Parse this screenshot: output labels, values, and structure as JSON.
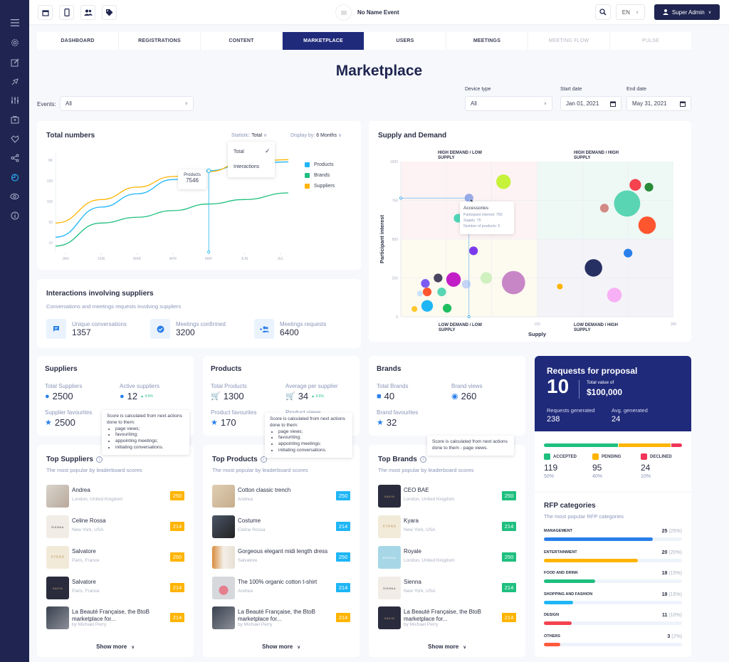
{
  "sidebar": {
    "items": [
      {
        "icon": "menu-icon"
      },
      {
        "icon": "gear-icon"
      },
      {
        "icon": "edit-icon"
      },
      {
        "icon": "rocket-icon"
      },
      {
        "icon": "sliders-icon"
      },
      {
        "icon": "briefcase-icon"
      },
      {
        "icon": "handshake-icon"
      },
      {
        "icon": "share-icon"
      },
      {
        "icon": "pie-chart-icon",
        "active": true
      },
      {
        "icon": "eye-icon"
      },
      {
        "icon": "info-icon"
      }
    ]
  },
  "topbar": {
    "event_name": "No Name Event",
    "language": "EN",
    "user": "Super Admin"
  },
  "tabs": [
    {
      "label": "DASHBOARD"
    },
    {
      "label": "REGISTRATIONS"
    },
    {
      "label": "CONTENT"
    },
    {
      "label": "MARKETPLACE",
      "active": true
    },
    {
      "label": "USERS"
    },
    {
      "label": "MEETINGS"
    },
    {
      "label": "MEETING FLOW",
      "disabled": true
    },
    {
      "label": "PULSE",
      "disabled": true
    }
  ],
  "page_title": "Marketplace",
  "filters": {
    "events_label": "Events:",
    "events_value": "All",
    "device_label": "Device type",
    "device_value": "All",
    "start_label": "Start date",
    "start_value": "Jan 01, 2021",
    "end_label": "End date",
    "end_value": "May 31, 2021"
  },
  "total_numbers": {
    "title": "Total numbers",
    "statistic_label": "Statistic:",
    "statistic_value": "Total",
    "display_label": "Display by:",
    "display_value": "6 Months",
    "dropdown_options": [
      "Total",
      "Interactions"
    ],
    "tooltip_label": "Products",
    "tooltip_value": "7546"
  },
  "chart_data": [
    {
      "type": "line",
      "title": "Total numbers",
      "categories": [
        "JAN",
        "FEB",
        "MAR",
        "APR",
        "MAY",
        "JUN",
        "JUL"
      ],
      "y_ticks": [
        "10",
        "50",
        "100",
        "150",
        "9K"
      ],
      "series": [
        {
          "name": "Products",
          "color": "#1eb6f5",
          "values": [
            10,
            78,
            108,
            140,
            160,
            175,
            180
          ]
        },
        {
          "name": "Brands",
          "color": "#1fbf7f",
          "values": [
            -10,
            42,
            55,
            70,
            85,
            95,
            110
          ]
        },
        {
          "name": "Suppliers",
          "color": "#ffb400",
          "values": [
            42,
            95,
            123,
            147,
            158,
            180,
            185
          ]
        }
      ],
      "legend": "right",
      "highlight": {
        "series": "Products",
        "category": "MAY",
        "value": 7546
      }
    },
    {
      "type": "scatter",
      "title": "Supply and Demand",
      "xlabel": "Supply",
      "ylabel": "Participant interest",
      "xlim": [
        0,
        300
      ],
      "ylim": [
        0,
        1000
      ],
      "x_ticks": [
        "150",
        "300"
      ],
      "y_ticks": [
        "0",
        "250",
        "500",
        "750",
        "1000"
      ],
      "quadrants": [
        "HIGH DEMAND / LOW SUPPLY",
        "HIGH DEMAND / HIGH SUPPLY",
        "LOW DEMAND / LOW SUPPLY",
        "LOW DEMAND / HIGH SUPPLY"
      ],
      "points": [
        {
          "x": 113,
          "y": 870,
          "r": 4,
          "color": "#c6f23a"
        },
        {
          "x": 75,
          "y": 765,
          "r": 2,
          "color": "#9aa9e8",
          "label": "Accessories"
        },
        {
          "x": 71,
          "y": 657,
          "r": 3,
          "color": "#ff5630"
        },
        {
          "x": 63,
          "y": 635,
          "r": 2,
          "color": "#4fd6b8"
        },
        {
          "x": 80,
          "y": 425,
          "r": 2,
          "color": "#7c3aed"
        },
        {
          "x": 41,
          "y": 250,
          "r": 2,
          "color": "#4a4560"
        },
        {
          "x": 27,
          "y": 215,
          "r": 2,
          "color": "#7c5cf0"
        },
        {
          "x": 58,
          "y": 240,
          "r": 4,
          "color": "#c21ec7"
        },
        {
          "x": 72,
          "y": 210,
          "r": 2,
          "color": "#c5d3f5"
        },
        {
          "x": 94,
          "y": 250,
          "r": 3,
          "color": "#d0f0c0"
        },
        {
          "x": 29,
          "y": 160,
          "r": 2,
          "color": "#ff5630"
        },
        {
          "x": 45,
          "y": 160,
          "r": 2,
          "color": "#58d6b4"
        },
        {
          "x": 21,
          "y": 150,
          "r": 1,
          "color": "#c8e4fb"
        },
        {
          "x": 29,
          "y": 70,
          "r": 3,
          "color": "#1eb6f5"
        },
        {
          "x": 51,
          "y": 55,
          "r": 2,
          "color": "#1fbf5f"
        },
        {
          "x": 15,
          "y": 50,
          "r": 1,
          "color": "#ffc72c"
        },
        {
          "x": 124,
          "y": 220,
          "r": 7,
          "color": "#c786c6"
        },
        {
          "x": 175,
          "y": 195,
          "r": 1,
          "color": "#ffb400"
        },
        {
          "x": 212,
          "y": 315,
          "r": 5,
          "color": "#273062"
        },
        {
          "x": 235,
          "y": 140,
          "r": 4,
          "color": "#f7b0f5"
        },
        {
          "x": 250,
          "y": 410,
          "r": 2,
          "color": "#2a7fe8"
        },
        {
          "x": 224,
          "y": 700,
          "r": 2,
          "color": "#d38a86"
        },
        {
          "x": 249,
          "y": 730,
          "r": 8,
          "color": "#5ad5b4"
        },
        {
          "x": 258,
          "y": 850,
          "r": 3,
          "color": "#f5424e"
        },
        {
          "x": 273,
          "y": 835,
          "r": 2,
          "color": "#2a8c3a"
        },
        {
          "x": 271,
          "y": 590,
          "r": 5,
          "color": "#ff5630"
        }
      ],
      "tooltip": {
        "title": "Accessories",
        "lines": [
          "Participant interest: 750",
          "Supply: 75",
          "Number of products: 5"
        ]
      }
    }
  ],
  "interactions": {
    "title": "Interactions involving suppliers",
    "subtitle": "Conversations and meetings requests involving suppliers",
    "stats": [
      {
        "label": "Unique conversations",
        "value": "1357",
        "icon": "chat-icon"
      },
      {
        "label": "Meetings confirmed",
        "value": "3200",
        "icon": "check-circle-icon"
      },
      {
        "label": "Meetings requests",
        "value": "6400",
        "icon": "group-add-icon"
      }
    ]
  },
  "suppliers": {
    "title": "Suppliers",
    "total_label": "Total Suppliers",
    "total_value": "2500",
    "active_label": "Active suppliers",
    "active_value": "12",
    "active_trend": "▲ 4.5%",
    "fav_label": "Supplier favourites",
    "fav_value": "2500"
  },
  "products": {
    "title": "Products",
    "total_label": "Total Products",
    "total_value": "1300",
    "avg_label": "Average  per supplier",
    "avg_value": "34",
    "avg_trend": "▲ 4.5%",
    "fav_label": "Product favourites",
    "fav_value": "170",
    "views_label": "Product views"
  },
  "brands": {
    "title": "Brands",
    "total_label": "Total Brands",
    "total_value": "40",
    "views_label": "Brand views",
    "views_value": "260",
    "fav_label": "Brand favourites",
    "fav_value": "32"
  },
  "score_tip": {
    "intro": "Score is calculated from next actions done to them:",
    "bullets": [
      "page views;",
      "favouriting;",
      "appointing meetings;",
      "initiating conversations."
    ],
    "brands_text": "Score is calculated from next actions done to them - page views."
  },
  "top_suppliers": {
    "title": "Top Suppliers",
    "subtitle": "The most popular by leaderboard scores",
    "show_more": "Show more",
    "items": [
      {
        "name": "Andrea",
        "sub": "London, United Kingdom",
        "score": "250"
      },
      {
        "name": "Celine Rossa",
        "sub": "New York, USA",
        "score": "214",
        "logo": "SIENNA"
      },
      {
        "name": "Salvatore",
        "sub": "Paris, France",
        "score": "250",
        "logo": "KYARA"
      },
      {
        "name": "Salvatore",
        "sub": "Paris, France",
        "score": "214",
        "logo": "SAVIN"
      },
      {
        "name": "La Beauté Française, the BtoB marketplace for...",
        "sub": "by Michael Perry",
        "score": "214"
      }
    ]
  },
  "top_products": {
    "title": "Top Products",
    "subtitle": "The most popular by leaderboard scores",
    "show_more": "Show more",
    "items": [
      {
        "name": "Cotton classic trench",
        "sub": "Andrea",
        "score": "250"
      },
      {
        "name": "Costume",
        "sub": "Celine Rossa",
        "score": "214"
      },
      {
        "name": "Gorgeous elegant midi length dress",
        "sub": "Salvatore",
        "score": "250"
      },
      {
        "name": "The 100% organic cotton t-shirt",
        "sub": "Andrea",
        "score": "214"
      },
      {
        "name": "La Beauté Française, the BtoB marketplace for...",
        "sub": "by Michael Perry",
        "score": "214"
      }
    ]
  },
  "top_brands": {
    "title": "Top Brands",
    "subtitle": "The most popular by leaderboard scores",
    "show_more": "Show more",
    "items": [
      {
        "name": "CEO BAE",
        "sub": "London, United Kingdom",
        "score": "250",
        "logo": "SAVIN"
      },
      {
        "name": "Kyara",
        "sub": "New York, USA",
        "score": "214",
        "logo": "KYARA"
      },
      {
        "name": "Royale",
        "sub": "London, United Kingdom",
        "score": "250",
        "logo": "ROYALE"
      },
      {
        "name": "Sienna",
        "sub": "New York, USA",
        "score": "214",
        "logo": "SIENNA"
      },
      {
        "name": "La Beauté Française, the BtoB marketplace for...",
        "sub": "by Michael Perry",
        "score": "214",
        "logo": "SAVIN"
      }
    ]
  },
  "rfp": {
    "title": "Requests for proposal",
    "count": "10",
    "total_label": "Total value of",
    "total_value": "$100,000",
    "generated_label": "Requests generated",
    "generated_value": "238",
    "avg_label": "Avg. generated",
    "avg_value": "24",
    "statuses": [
      {
        "label": "ACCEPTED",
        "value": "119",
        "pct": "50%",
        "share": 0.54,
        "color": "#1fbf7f"
      },
      {
        "label": "PENDING",
        "value": "95",
        "pct": "40%",
        "share": 0.38,
        "color": "#ffb400"
      },
      {
        "label": "DECLINED",
        "value": "24",
        "pct": "10%",
        "share": 0.08,
        "color": "#f0345a"
      }
    ]
  },
  "rfp_categories": {
    "title": "RFP categories",
    "subtitle": "The most popular RFP categories",
    "items": [
      {
        "label": "MANAGEMENT",
        "value": "25",
        "pct": "(25%)",
        "fill": 0.79,
        "color": "#2a7fe8"
      },
      {
        "label": "ENTERTAINMENT",
        "value": "20",
        "pct": "(20%)",
        "fill": 0.68,
        "color": "#ffb400"
      },
      {
        "label": "FOOD AND DRINK",
        "value": "18",
        "pct": "(15%)",
        "fill": 0.37,
        "color": "#1fbf7f"
      },
      {
        "label": "SHOPPING AND FASHION",
        "value": "18",
        "pct": "(15%)",
        "fill": 0.21,
        "color": "#1eb6f5"
      },
      {
        "label": "DESIGN",
        "value": "11",
        "pct": "(10%)",
        "fill": 0.2,
        "color": "#f5424e"
      },
      {
        "label": "OTHERS",
        "value": "3",
        "pct": "(2%)",
        "fill": 0.12,
        "color": "#ff5a3c"
      }
    ]
  }
}
